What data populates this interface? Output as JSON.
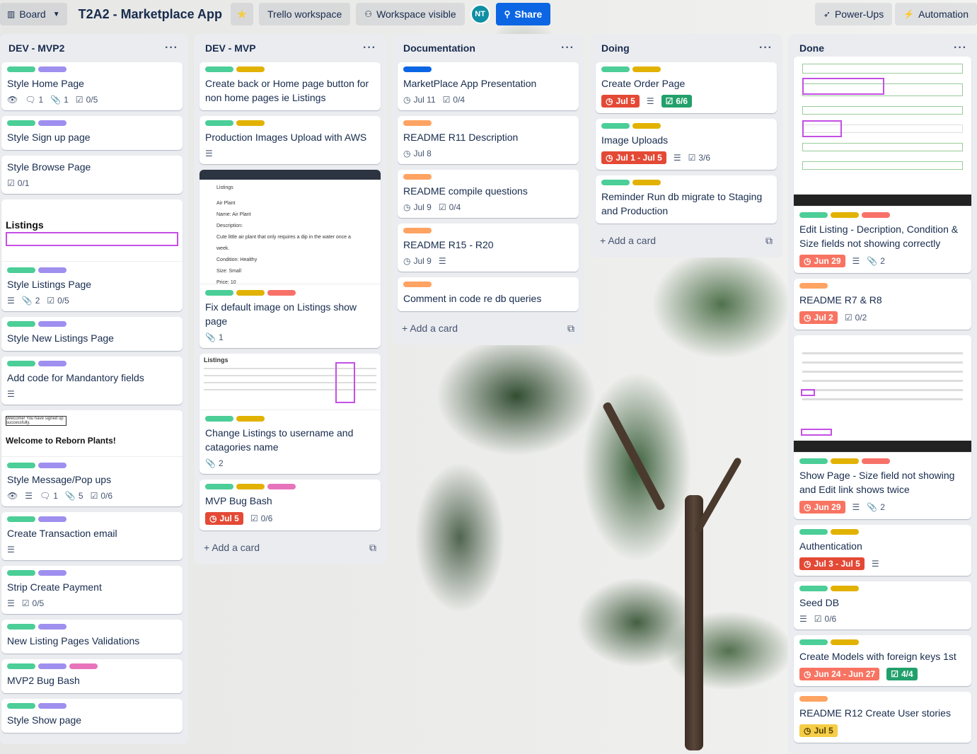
{
  "header": {
    "view_label": "Board",
    "board_title": "T2A2 - Marketplace App",
    "workspace": "Trello workspace",
    "visibility": "Workspace visible",
    "avatar_initials": "NT",
    "share": "Share",
    "powerups": "Power-Ups",
    "automation": "Automation"
  },
  "colors": {
    "green": "#4bce97",
    "purple": "#9f8fef",
    "yellow": "#e2b203",
    "red": "#f87168",
    "orange": "#fea362",
    "blue": "#0c66e4",
    "pink": "#e774bb"
  },
  "add_card": "Add a card",
  "lists": [
    {
      "title": "DEV - MVP2",
      "cards": [
        {
          "title": "Style Home Page",
          "comments": "1",
          "attachments": "1",
          "checklist": "0/5"
        },
        {
          "title": "Style Sign up page"
        },
        {
          "title": "Style Browse Page",
          "checklist": "0/1"
        },
        {
          "title": "Style Listings Page",
          "attachments": "2",
          "checklist": "0/5",
          "thumb_title": "Listings"
        },
        {
          "title": "Style New Listings Page"
        },
        {
          "title": "Add code for Mandantory fields"
        },
        {
          "title": "Style Message/Pop ups",
          "comments": "1",
          "attachments": "5",
          "checklist": "0/6",
          "thumb_title": "Welcome to Reborn Plants!",
          "thumb_banner": "Welcome! You have signed up successfully."
        },
        {
          "title": "Create Transaction email"
        },
        {
          "title": "Strip Create Payment",
          "checklist": "0/5"
        },
        {
          "title": "New Listing Pages Validations"
        },
        {
          "title": "MVP2 Bug Bash"
        },
        {
          "title": "Style Show page"
        }
      ]
    },
    {
      "title": "DEV - MVP",
      "cards": [
        {
          "title": "Create back or Home page button for non home pages ie Listings"
        },
        {
          "title": "Production Images Upload with AWS"
        },
        {
          "title": "Fix default image on Listings show page",
          "attachments": "1",
          "thumb_title": "Listings",
          "thumb_lines": [
            "Air Plant",
            "Name: Air Plant",
            "Description:",
            "Cute little air plant that only requires a dip in the water once a week.",
            "Condition: Healthy",
            "Size: Small",
            "Price: 10"
          ]
        },
        {
          "title": "Change Listings to username and catagories name",
          "attachments": "2",
          "thumb_title": "Listings"
        },
        {
          "title": "MVP Bug Bash",
          "due": "Jul 5",
          "checklist": "0/6"
        }
      ]
    },
    {
      "title": "Documentation",
      "cards": [
        {
          "title": "MarketPlace App Presentation",
          "date": "Jul 11",
          "checklist": "0/4"
        },
        {
          "title": "README R11 Description",
          "date": "Jul 8"
        },
        {
          "title": "README compile questions",
          "date": "Jul 9",
          "checklist": "0/4"
        },
        {
          "title": "README R15 - R20",
          "date": "Jul 9"
        },
        {
          "title": "Comment in code re db queries"
        }
      ]
    },
    {
      "title": "Doing",
      "cards": [
        {
          "title": "Create Order Page",
          "due": "Jul 5",
          "checklist": "6/6"
        },
        {
          "title": "Image Uploads",
          "due": "Jul 1 - Jul 5",
          "checklist": "3/6"
        },
        {
          "title": "Reminder Run db migrate to Staging and Production"
        }
      ]
    },
    {
      "title": "Done",
      "cards": [
        {
          "title": "Edit Listing - Decription, Condition & Size fields not showing correctly",
          "due": "Jun 29",
          "attachments": "2"
        },
        {
          "title": "README R7 & R8",
          "due": "Jul 2",
          "checklist": "0/2"
        },
        {
          "title": "Show Page - Size field not showing and Edit link shows twice",
          "due": "Jun 29",
          "attachments": "2"
        },
        {
          "title": "Authentication",
          "due": "Jul 3 - Jul 5"
        },
        {
          "title": "Seed DB",
          "checklist": "0/6"
        },
        {
          "title": "Create Models with foreign keys 1st",
          "due": "Jun 24 - Jun 27",
          "checklist": "4/4"
        },
        {
          "title": "README R12 Create User stories",
          "due": "Jul 5"
        }
      ]
    }
  ]
}
